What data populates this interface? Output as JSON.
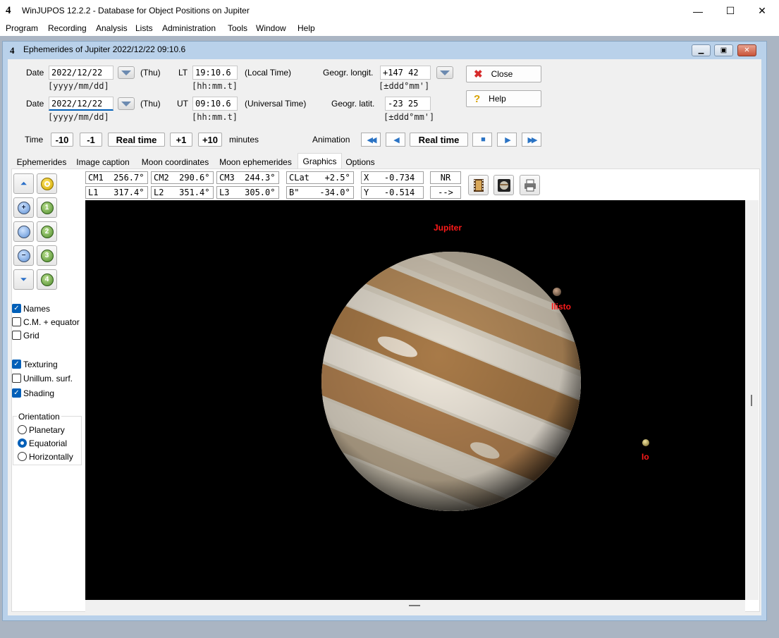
{
  "window": {
    "title": "WinJUPOS 12.2.2 - Database for Object Positions on Jupiter",
    "minimize": "—",
    "maximize": "☐",
    "close": "✕"
  },
  "menu": [
    "Program",
    "Recording",
    "Analysis",
    "Lists",
    "Administration",
    "Tools",
    "Window",
    "Help"
  ],
  "child_window": {
    "title": "Ephemerides of Jupiter  2022/12/22  09:10.6"
  },
  "form": {
    "date_label": "Date",
    "date_lt": "2022/12/22",
    "date_ut": "2022/12/22",
    "date_hint": "[yyyy/mm/dd]",
    "weekday": "(Thu)",
    "lt_label": "LT",
    "lt_value": "19:10.6",
    "lt_desc": "(Local Time)",
    "ut_label": "UT",
    "ut_value": "09:10.6",
    "ut_desc": "(Universal Time)",
    "time_hint": "[hh:mm.t]",
    "longit_label": "Geogr. longit.",
    "longit_value": "+147 42",
    "latit_label": "Geogr. latit.",
    "latit_value": "-23 25",
    "coord_hint": "[±ddd°mm']",
    "close_button": "Close",
    "help_button": "Help"
  },
  "time_row": {
    "label": "Time",
    "minus10": "-10",
    "minus1": "-1",
    "realtime": "Real time",
    "plus1": "+1",
    "plus10": "+10",
    "minutes": "minutes",
    "animation_label": "Animation",
    "anim_realtime": "Real time"
  },
  "tabs": [
    "Ephemerides",
    "Image caption",
    "Moon coordinates",
    "Moon ephemerides",
    "Graphics",
    "Options"
  ],
  "active_tab": "Graphics",
  "info": {
    "cm1": "CM1  256.7°",
    "cm2": "CM2  290.6°",
    "cm3": "CM3  244.3°",
    "clat": "CLat   +2.5°",
    "x": "X   -0.734",
    "nr": "NR",
    "l1": "L1   317.4°",
    "l2": "L2   351.4°",
    "l3": "L3   305.0°",
    "b2": "B\"    -34.0°",
    "y": "Y   -0.514",
    "arrow": "-->"
  },
  "moon_buttons": [
    "1",
    "2",
    "3",
    "4"
  ],
  "checks": {
    "names": {
      "label": "Names",
      "checked": true
    },
    "cm_equator": {
      "label": "C.M. + equator",
      "checked": false
    },
    "grid": {
      "label": "Grid",
      "checked": false
    },
    "texturing": {
      "label": "Texturing",
      "checked": true
    },
    "unillum": {
      "label": "Unillum. surf.",
      "checked": false
    },
    "shading": {
      "label": "Shading",
      "checked": true
    }
  },
  "orientation": {
    "title": "Orientation",
    "planetary": "Planetary",
    "equatorial": "Equatorial",
    "horizontally": "Horizontally",
    "selected": "Equatorial"
  },
  "graphics": {
    "jupiter_label": "Jupiter",
    "callisto_label": "llisto",
    "io_label": "Io"
  },
  "colors": {
    "accent": "#005fb8",
    "label_red": "#ff1a1a"
  }
}
